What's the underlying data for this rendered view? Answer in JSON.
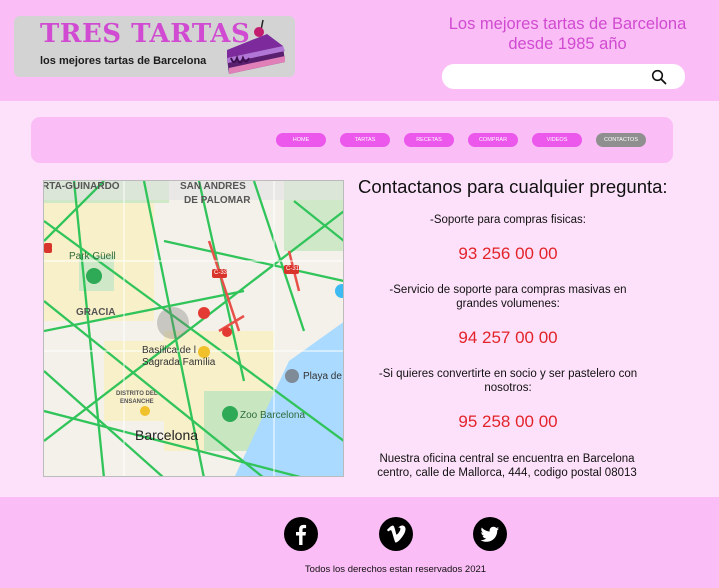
{
  "header": {
    "logo_title": "TRES TARTAS",
    "logo_subtitle": "los mejores tartas de Barcelona",
    "tagline_line1": "Los mejores tartas de Barcelona",
    "tagline_line2": "desde 1985 año",
    "search": {
      "placeholder": "",
      "value": ""
    }
  },
  "nav": {
    "items": [
      {
        "label": "HOME",
        "active": false
      },
      {
        "label": "TARTAS",
        "active": false
      },
      {
        "label": "RECETAS",
        "active": false
      },
      {
        "label": "COMPRAR",
        "active": false
      },
      {
        "label": "VIDEOS",
        "active": false
      },
      {
        "label": "CONTACTOS",
        "active": true
      }
    ]
  },
  "map": {
    "labels": {
      "guinardo": "RTA-GUINARDÓ",
      "san_andres": "SAN ANDRÉS",
      "de_palomar": "DE PALOMAR",
      "park_guell": "Park Güell",
      "gracia": "GRACIA",
      "basilica_1": "Basílica de l",
      "basilica_2": "Sagrada Família",
      "distrito_1": "DISTRITO DEL",
      "distrito_2": "ENSANCHE",
      "barcelona": "Barcelona",
      "zoo": "Zoo Barcelona",
      "playa": "Playa de",
      "c33": "C-33",
      "c31": "C-31"
    }
  },
  "contact": {
    "title": "Contactanos para cualquier pregunta:",
    "sections": [
      {
        "label": "-Soporte para compras fisicas:",
        "phone": "93 256 00 00"
      },
      {
        "label": "-Servicio de soporte para compras masivas en grandes volumenes:",
        "phone": "94 257 00 00"
      },
      {
        "label": "-Si quieres convertirte en socio y ser pastelero con nosotros:",
        "phone": "95 258 00 00"
      }
    ],
    "office": "Nuestra oficina central se encuentra en Barcelona centro, calle de Mallorca, 444, codigo postal 08013"
  },
  "footer": {
    "social": [
      {
        "icon": "facebook-icon",
        "glyph": "f"
      },
      {
        "icon": "vimeo-icon",
        "glyph": "v"
      },
      {
        "icon": "twitter-icon",
        "glyph": "twitter"
      }
    ],
    "copyright": "Todos los derechos estan reservados 2021"
  },
  "colors": {
    "header_bg": "#fbbdf6",
    "page_bg": "#fde1fa",
    "accent_magenta": "#d04bd1",
    "nav_button": "#ec58ec",
    "nav_active": "#8f8f8f",
    "phone_red": "#e2232a"
  }
}
